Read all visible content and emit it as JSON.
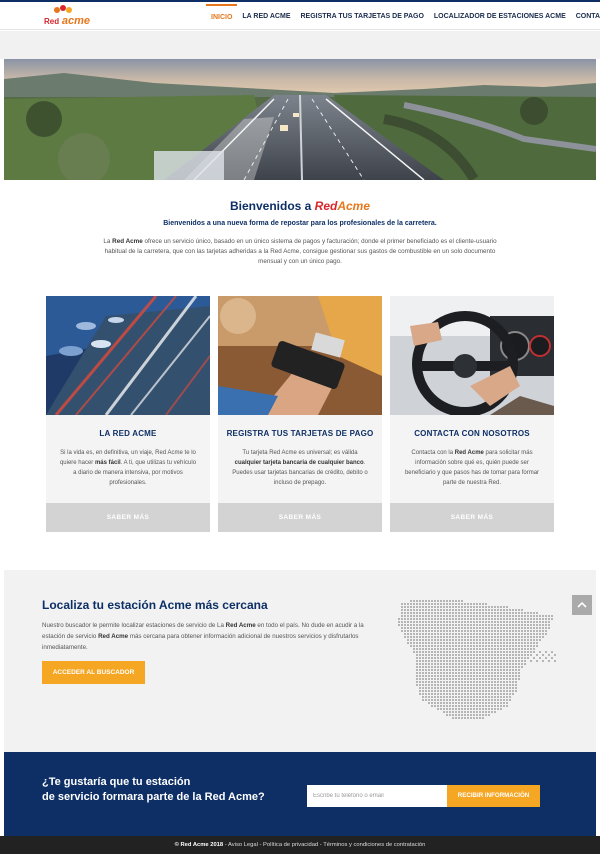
{
  "header": {
    "logo_red": "Red",
    "logo_acme": "acme",
    "nav": [
      "INICIO",
      "LA RED ACME",
      "REGISTRA TUS TARJETAS DE PAGO",
      "LOCALIZADOR DE ESTACIONES ACME",
      "CONTACTO"
    ],
    "active_index": 0
  },
  "welcome": {
    "title_prefix": "Bienvenidos a",
    "title_red": "Red",
    "title_acme": "Acme",
    "subtitle": "Bienvenidos a una nueva forma de repostar para los profesionales de la carretera.",
    "body_pre": "La ",
    "body_bold": "Red Acme",
    "body_post": " ofrece un servicio único, basado en un único sistema de pagos y facturación; donde el primer beneficiado es el cliente-usuario habitual de la carretera, que con las tarjetas adheridas a la Red Acme, consigue gestionar sus gastos de combustible en un solo documento mensual y con un único pago."
  },
  "cards": [
    {
      "image": "highway-traffic-photo",
      "title": "LA RED ACME",
      "text_a": "Si la vida es, en definitiva, un viaje, Red Acme te lo quiere hacer ",
      "text_bold": "más fácil",
      "text_b": ". A ti, que utilizas tu vehículo a diario de manera intensiva, por motivos profesionales.",
      "button": "SABER MÁS"
    },
    {
      "image": "card-payment-terminal-photo",
      "title": "REGISTRA TUS TARJETAS DE PAGO",
      "text_a": "Tu tarjeta Red Acme es universal; es válida ",
      "text_bold": "cualquier tarjeta bancaria de cualquier banco",
      "text_b": ". Puedes usar tarjetas bancarias de crédito, debito o incluso de prepago.",
      "button": "SABER MÁS"
    },
    {
      "image": "steering-wheel-photo",
      "title": "CONTACTA CON NOSOTROS",
      "text_a": "Contacta con la ",
      "text_bold": "Red Acme",
      "text_b": " para solicitar más información sobre qué es, quién puede ser beneficiario y que pasos has de tomar para formar parte de nuestra Red.",
      "button": "SABER MÁS"
    }
  ],
  "locator": {
    "title": "Localiza tu estación Acme más cercana",
    "text_a": "Nuestro buscador le permite localizar estaciones de servicio de La ",
    "text_bold1": "Red Acme",
    "text_b": " en todo el país. No dude en acudir a la estación de servicio ",
    "text_bold2": "Red Acme",
    "text_c": " más cercana para obtener información adicional de nuestros servicios y disfrutarlos inmediatamente.",
    "button": "ACCEDER AL BUSCADOR"
  },
  "cta": {
    "line1": "¿Te gustaría que tu estación",
    "line2": "de servicio formara parte de la Red Acme?",
    "input_placeholder": "Escribe tu teléfono o email",
    "button": "RECIBIR INFORMACIÓN"
  },
  "footer": {
    "brand": "© Red Acme 2018",
    "links": [
      "Aviso Legal",
      "Política de privacidad",
      "Términos y condiciones de contratación"
    ]
  },
  "colors": {
    "navy": "#0d2f66",
    "orange": "#f5a623",
    "brand_red": "#d8262b",
    "brand_orange": "#e6771c"
  }
}
